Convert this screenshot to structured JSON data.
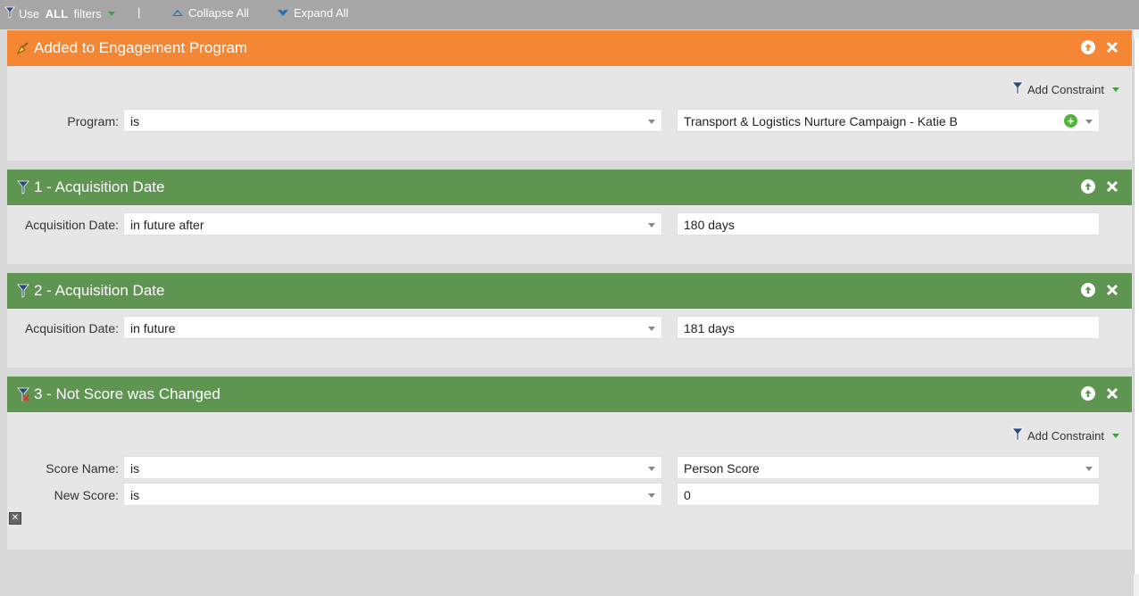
{
  "toolbar": {
    "use_prefix": "Use ",
    "use_all": "ALL",
    "use_suffix": " filters",
    "separator": "|",
    "collapse_all": "Collapse All",
    "expand_all": "Expand All"
  },
  "filters": [
    {
      "title": "Added to Engagement Program",
      "color": "#f58634",
      "add_constraint": "Add Constraint",
      "rows": [
        {
          "label": "Program:",
          "operator": "is",
          "value": "Transport & Logistics Nurture Campaign - Katie B"
        }
      ]
    },
    {
      "title": "1 - Acquisition Date",
      "color": "#5e9550",
      "rows": [
        {
          "label": "Acquisition Date:",
          "operator": "in future after",
          "value": "180 days"
        }
      ]
    },
    {
      "title": "2 - Acquisition Date",
      "color": "#5e9550",
      "rows": [
        {
          "label": "Acquisition Date:",
          "operator": "in future",
          "value": "181 days"
        }
      ]
    },
    {
      "title": "3 - Not Score was Changed",
      "color": "#5e9550",
      "add_constraint": "Add Constraint",
      "rows": [
        {
          "label": "Score Name:",
          "operator": "is",
          "value": "Person Score"
        },
        {
          "label": "New Score:",
          "operator": "is",
          "value": "0"
        }
      ]
    }
  ]
}
